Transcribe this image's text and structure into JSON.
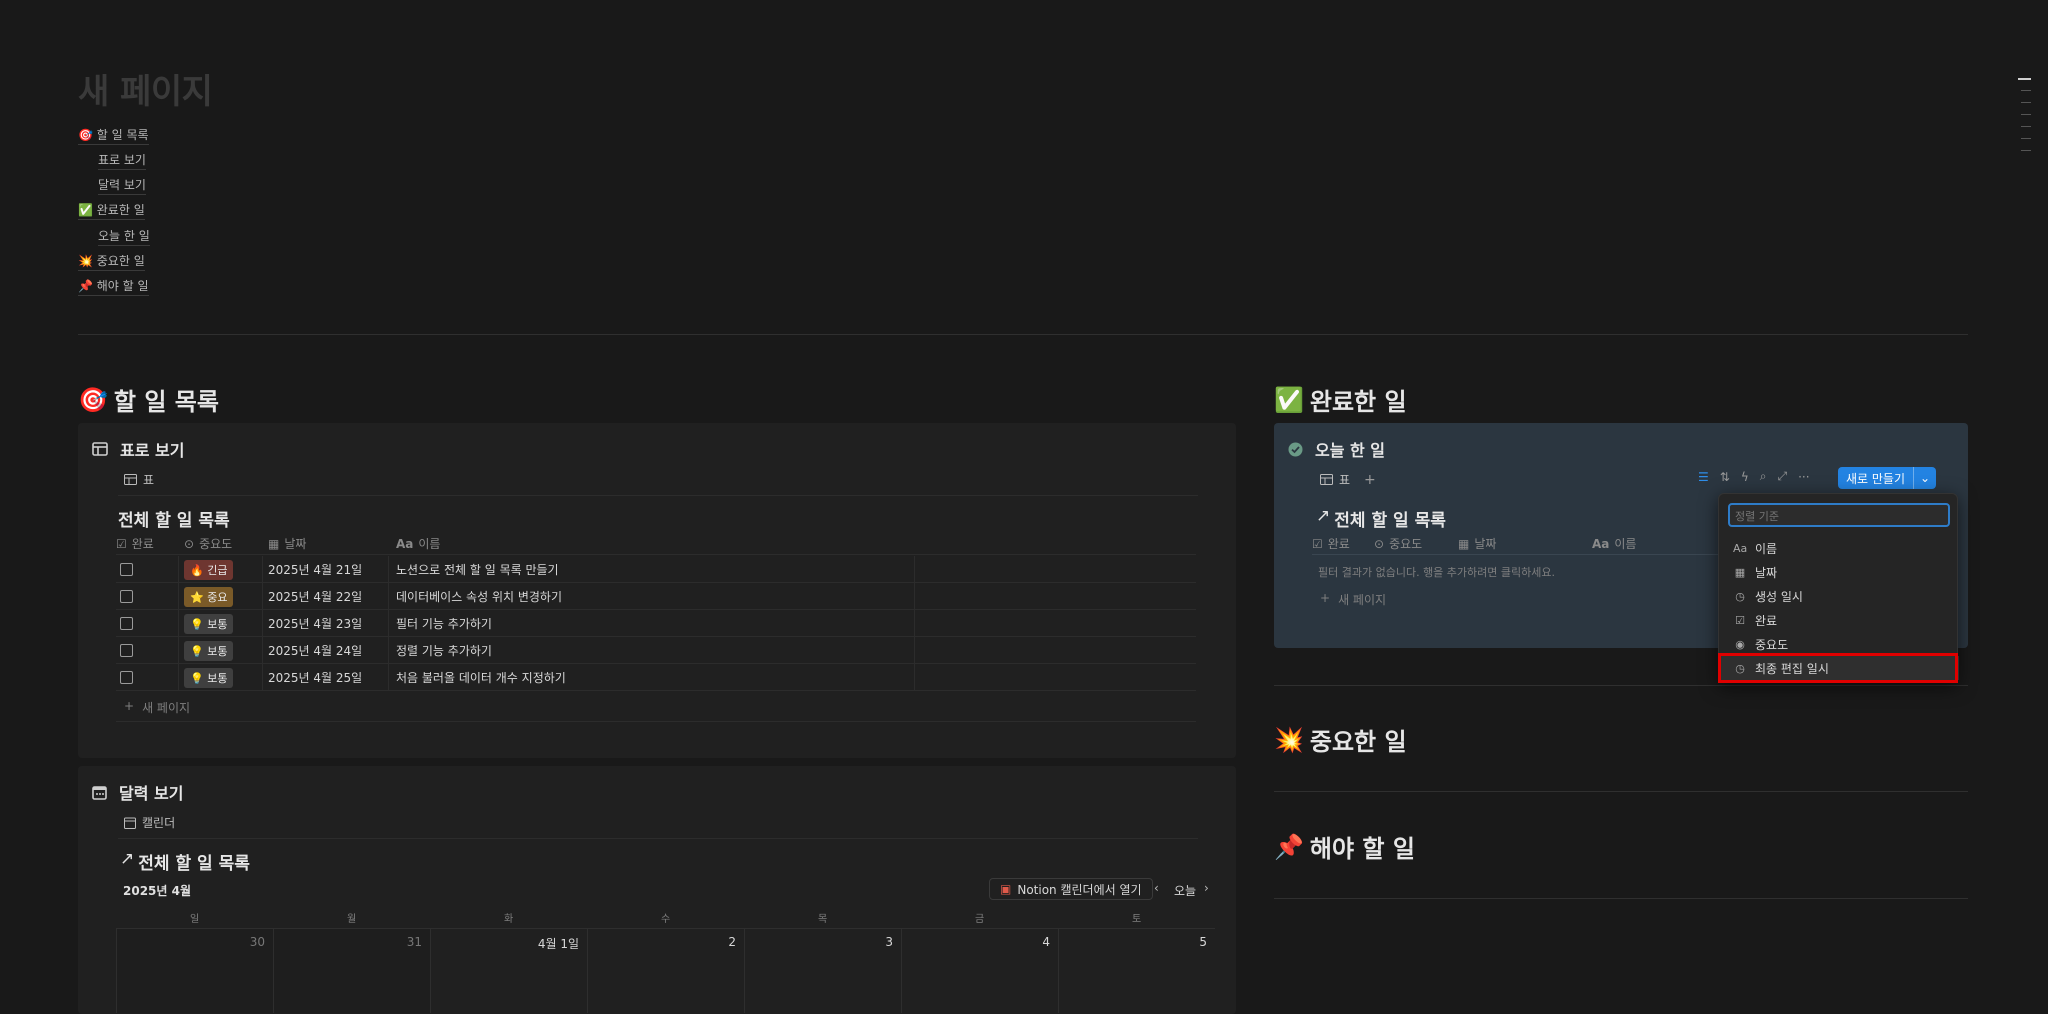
{
  "page": {
    "title": "새 페이지"
  },
  "toc": [
    "🎯 할 일 목록",
    "표로 보기",
    "달력 보기",
    "✅ 완료한 일",
    "오늘 한 일",
    "💥 중요한 일",
    "📌 해야 할 일"
  ],
  "left": {
    "heading": "할 일 목록",
    "heading_emoji": "🎯",
    "table_view": {
      "title": "표로 보기",
      "tab_label": "표",
      "db_title": "전체 할 일 목록",
      "columns": [
        "완료",
        "중요도",
        "날짜",
        "이름"
      ],
      "rows": [
        {
          "importance": "🔥 긴급",
          "importance_type": "urgent",
          "date": "2025년 4월 21일",
          "name": "노션으로 전체 할 일 목록 만들기"
        },
        {
          "importance": "⭐ 중요",
          "importance_type": "important",
          "date": "2025년 4월 22일",
          "name": "데이터베이스 속성 위치 변경하기"
        },
        {
          "importance": "💡 보통",
          "importance_type": "normal",
          "date": "2025년 4월 23일",
          "name": "필터 기능 추가하기"
        },
        {
          "importance": "💡 보통",
          "importance_type": "normal",
          "date": "2025년 4월 24일",
          "name": "정렬 기능 추가하기"
        },
        {
          "importance": "💡 보통",
          "importance_type": "normal",
          "date": "2025년 4월 25일",
          "name": "처음 불러올 데이터 개수 지정하기"
        }
      ],
      "new_page": "새 페이지"
    },
    "calendar_view": {
      "title": "달력 보기",
      "tab_label": "캘린더",
      "db_title": "전체 할 일 목록",
      "month": "2025년 4월",
      "open_in_calendar": "Notion 캘린더에서 열기",
      "today": "오늘",
      "weekdays": [
        "일",
        "월",
        "화",
        "수",
        "목",
        "금",
        "토"
      ],
      "days": [
        "30",
        "31",
        "4월 1일",
        "2",
        "3",
        "4",
        "5"
      ]
    }
  },
  "right": {
    "done": {
      "heading": "완료한 일",
      "heading_emoji": "✅",
      "view_title": "오늘 한 일",
      "tab_label": "표",
      "db_title": "전체 할 일 목록",
      "columns": [
        "완료",
        "중요도",
        "날짜",
        "이름"
      ],
      "empty_message": "필터 결과가 없습니다. 행을 추가하려면 클릭하세요.",
      "new_page": "새 페이지",
      "new_button": "새로 만들기"
    },
    "sort_menu": {
      "placeholder": "정렬 기준",
      "items": [
        {
          "icon": "Aa",
          "label": "이름"
        },
        {
          "icon": "▦",
          "label": "날짜"
        },
        {
          "icon": "◷",
          "label": "생성 일시"
        },
        {
          "icon": "☑",
          "label": "완료"
        },
        {
          "icon": "◉",
          "label": "중요도"
        },
        {
          "icon": "◷",
          "label": "최종 편집 일시"
        }
      ],
      "highlight_color": "#e00000"
    },
    "important": {
      "heading": "중요한 일",
      "heading_emoji": "💥"
    },
    "todo": {
      "heading": "해야 할 일",
      "heading_emoji": "📌"
    }
  }
}
